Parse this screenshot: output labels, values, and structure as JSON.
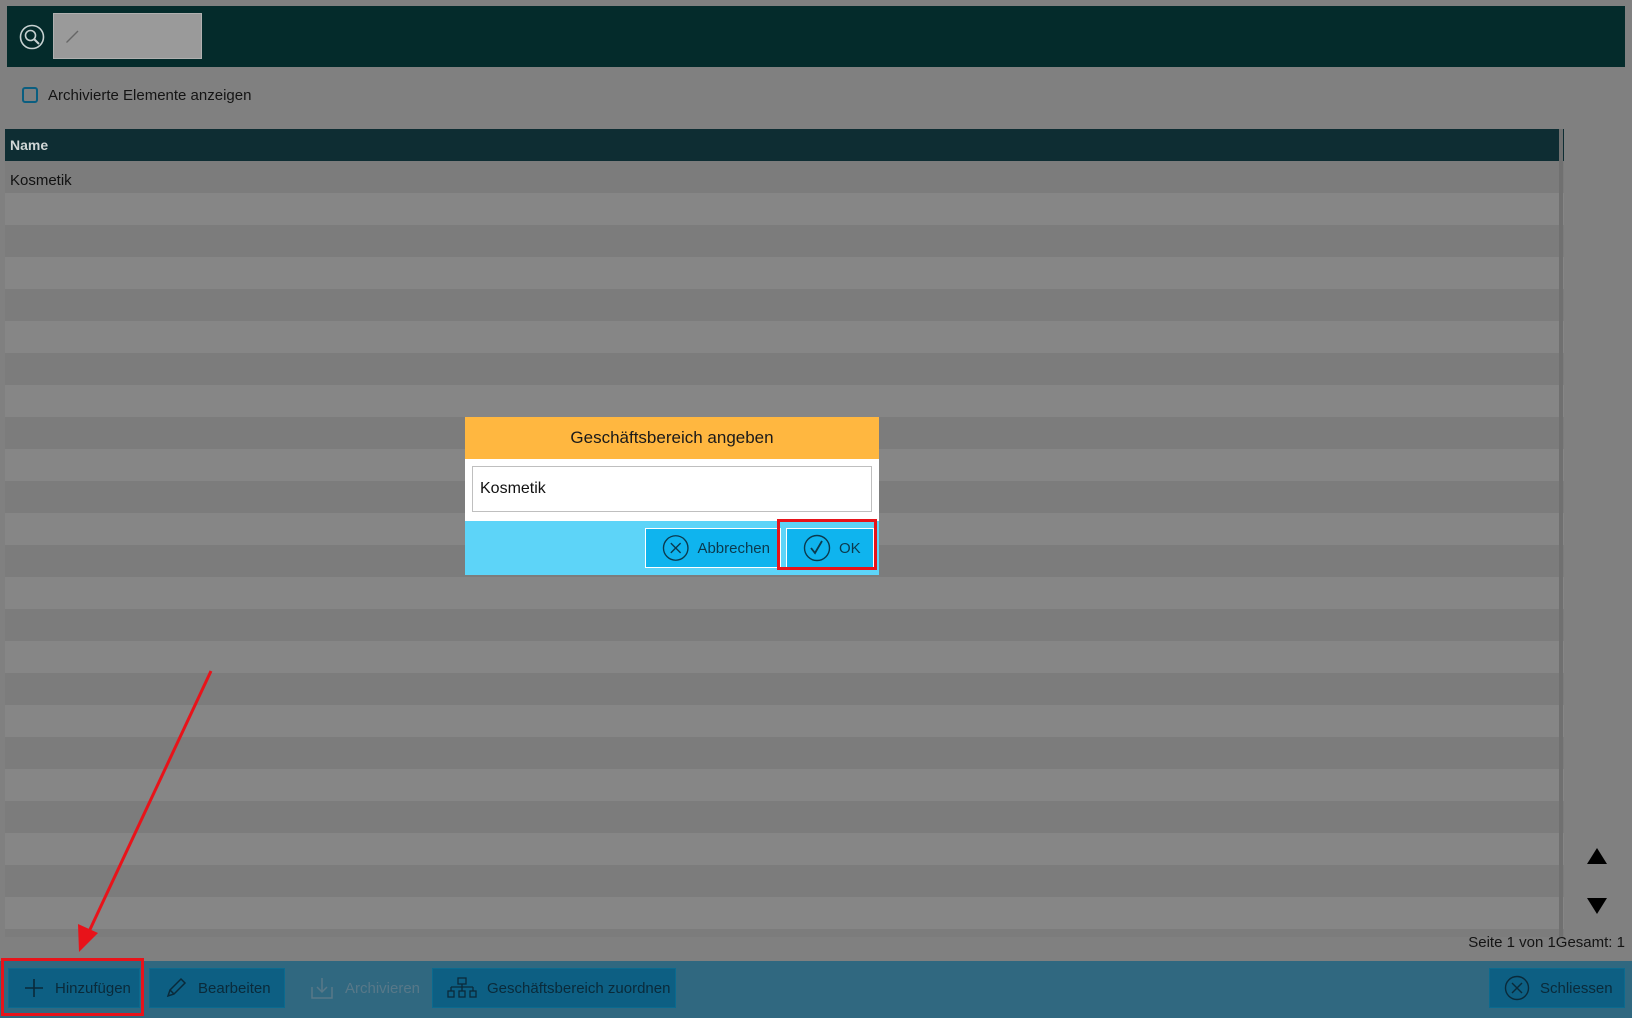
{
  "search": {
    "value": ""
  },
  "archive_toggle": {
    "label": "Archivierte Elemente anzeigen",
    "checked": false
  },
  "table": {
    "header_name": "Name",
    "rows": [
      {
        "name": "Kosmetik"
      }
    ]
  },
  "pager": {
    "text": "Seite 1 von 1Gesamt: 1"
  },
  "footer": {
    "add_label": "Hinzufügen",
    "edit_label": "Bearbeiten",
    "archive_label": "Archivieren",
    "assign_label": "Geschäftsbereich zuordnen",
    "close_label": "Schliessen"
  },
  "dialog": {
    "title": "Geschäftsbereich angeben",
    "input_value": "Kosmetik",
    "cancel_label": "Abbrechen",
    "ok_label": "OK"
  },
  "colors": {
    "topbar": "#042b2b",
    "table_header": "#0e2d33",
    "footer": "#306880",
    "dialog_header": "#ffb740",
    "dialog_actions": "#5dd4f8",
    "dialog_button": "#0fb4ee",
    "highlight": "#e8131a"
  },
  "icons": [
    "search-icon",
    "pencil-icon",
    "plus-icon",
    "edit-icon",
    "archive-icon",
    "hierarchy-icon",
    "close-circle-icon",
    "check-circle-icon",
    "arrow-up-icon",
    "arrow-down-icon"
  ]
}
